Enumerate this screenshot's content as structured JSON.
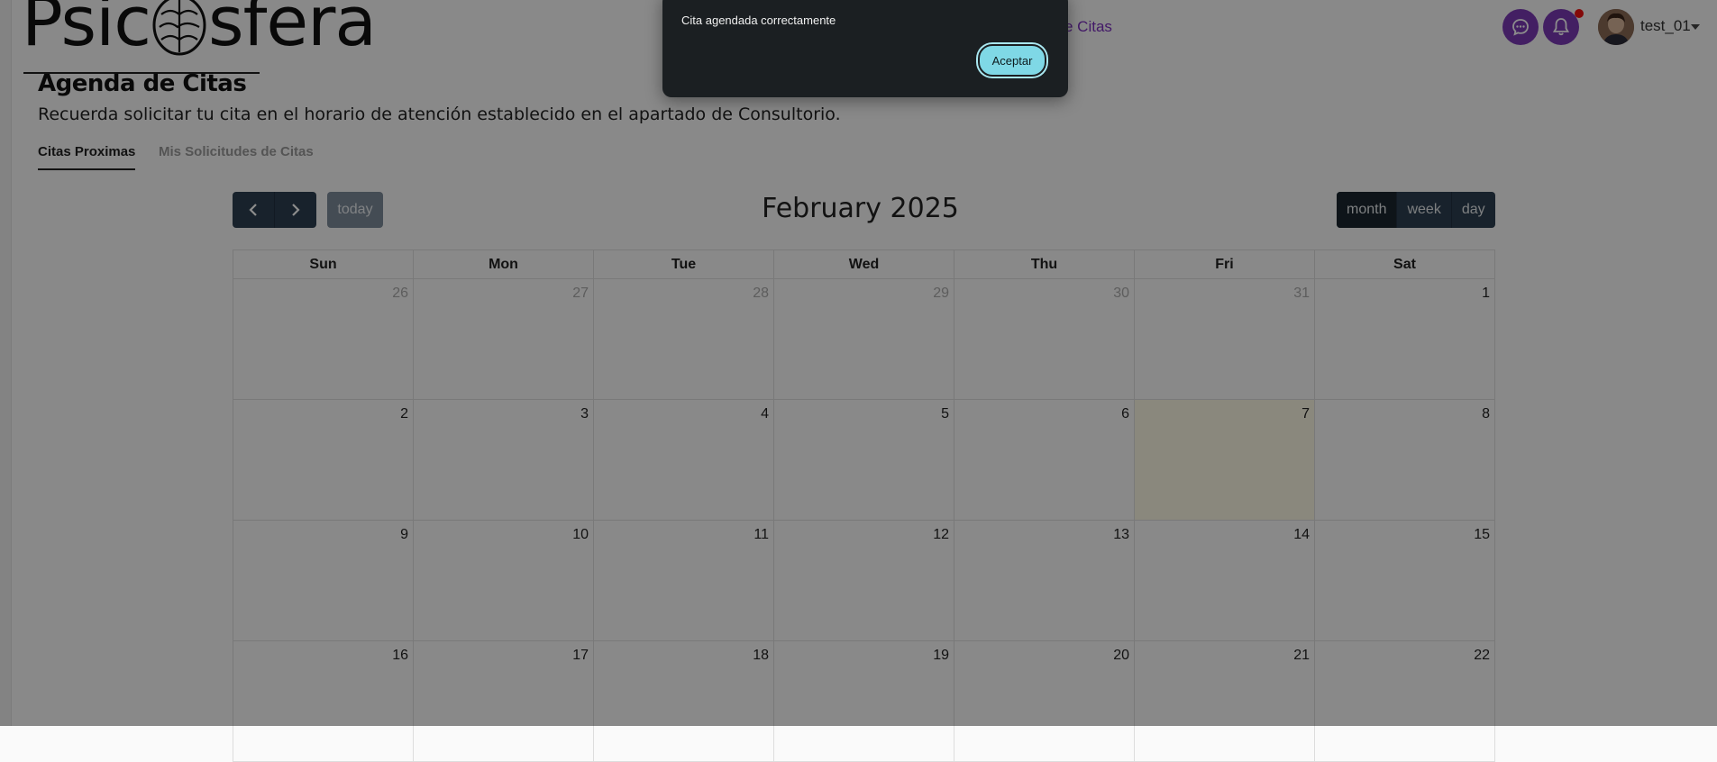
{
  "app": {
    "logo_text_left": "Psic",
    "logo_text_right": "sfera"
  },
  "header": {
    "nav_link": "e Citas",
    "user_name": "test_01",
    "icons": [
      "chat-bubble-icon",
      "bell-icon"
    ]
  },
  "page": {
    "title": "Agenda de Citas",
    "subtitle": "Recuerda solicitar tu cita en el horario de atención establecido en el apartado de Consultorio.",
    "tabs": [
      {
        "label": "Citas Proximas",
        "active": true
      },
      {
        "label": "Mis Solicitudes de Citas",
        "active": false
      }
    ]
  },
  "calendar": {
    "title": "February 2025",
    "today_label": "today",
    "views": [
      {
        "label": "month",
        "active": true
      },
      {
        "label": "week",
        "active": false
      },
      {
        "label": "day",
        "active": false
      }
    ],
    "weekdays": [
      "Sun",
      "Mon",
      "Tue",
      "Wed",
      "Thu",
      "Fri",
      "Sat"
    ],
    "weeks": [
      [
        "26",
        "27",
        "28",
        "29",
        "30",
        "31",
        "1"
      ],
      [
        "2",
        "3",
        "4",
        "5",
        "6",
        "7",
        "8"
      ],
      [
        "9",
        "10",
        "11",
        "12",
        "13",
        "14",
        "15"
      ],
      [
        "16",
        "17",
        "18",
        "19",
        "20",
        "21",
        "22"
      ]
    ],
    "other_month_days": [
      "26",
      "27",
      "28",
      "29",
      "30",
      "31"
    ],
    "today": "7"
  },
  "dialog": {
    "message": "Cita agendada correctamente",
    "confirm_label": "Aceptar"
  },
  "colors": {
    "accent_purple": "#7a3ab5",
    "dialog_bg": "#1b1f22",
    "dialog_button": "#7fd8e6",
    "today_highlight": "#fcf8e3",
    "toolbar_dark": "#2c3e50"
  }
}
